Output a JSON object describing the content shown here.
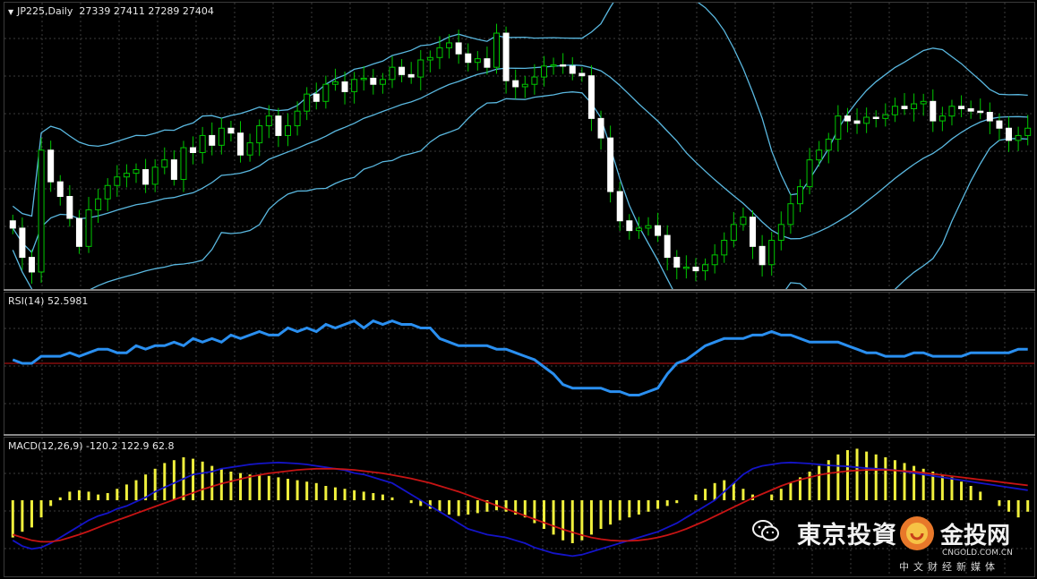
{
  "price_pane": {
    "symbol": "JP225,Daily",
    "ohlc": "27339 27411 27289 27404",
    "colors": {
      "bull": "#00c800",
      "bear": "#ffffff",
      "bands": "#5ab8e0",
      "grid": "#3c3c3c"
    },
    "chart_data": {
      "type": "candlestick",
      "bar_count": 108,
      "overlay": "Bollinger Bands",
      "closes": [
        26800,
        26560,
        26440,
        27440,
        27180,
        27060,
        26880,
        26650,
        26950,
        27040,
        27150,
        27220,
        27250,
        27280,
        27160,
        27300,
        27360,
        27200,
        27460,
        27420,
        27560,
        27480,
        27620,
        27580,
        27400,
        27500,
        27640,
        27720,
        27560,
        27640,
        27760,
        27900,
        27840,
        27980,
        28000,
        27920,
        28020,
        28030,
        27980,
        28020,
        28120,
        28060,
        28040,
        28180,
        28200,
        28280,
        28320,
        28230,
        28160,
        28190,
        28120,
        28400,
        28010,
        27960,
        27980,
        28040,
        28130,
        28140,
        28130,
        28070,
        28050,
        27700,
        27540,
        27100,
        26860,
        26780,
        26800,
        26820,
        26740,
        26560,
        26480,
        26480,
        26450,
        26500,
        26580,
        26700,
        26830,
        26890,
        26650,
        26500,
        26700,
        26830,
        27000,
        27140,
        27360,
        27440,
        27530,
        27720,
        27680,
        27660,
        27710,
        27700,
        27730,
        27800,
        27780,
        27820,
        27840,
        27680,
        27720,
        27800,
        27780,
        27760,
        27750,
        27680,
        27620,
        27520,
        27560,
        27620
      ]
    }
  },
  "rsi_pane": {
    "label": "RSI(14) 52.5981",
    "colors": {
      "line": "#2a8ff0",
      "level": "#c81414"
    },
    "chart_data": {
      "type": "line",
      "series": [
        {
          "name": "RSI(14)",
          "values": [
            51,
            50,
            50,
            52,
            52,
            52,
            53,
            52,
            53,
            54,
            54,
            53,
            53,
            55,
            54,
            55,
            55,
            56,
            55,
            57,
            56,
            57,
            56,
            58,
            57,
            58,
            59,
            58,
            58,
            60,
            59,
            60,
            59,
            61,
            60,
            61,
            62,
            60,
            62,
            61,
            62,
            61,
            61,
            60,
            60,
            57,
            56,
            55,
            55,
            55,
            55,
            54,
            54,
            53,
            52,
            51,
            49,
            47,
            44,
            43,
            43,
            43,
            43,
            42,
            42,
            41,
            41,
            42,
            43,
            47,
            50,
            51,
            53,
            55,
            56,
            57,
            57,
            57,
            58,
            58,
            59,
            58,
            58,
            57,
            56,
            56,
            56,
            56,
            55,
            54,
            53,
            53,
            52,
            52,
            52,
            53,
            53,
            52,
            52,
            52,
            52,
            53,
            53,
            53,
            53,
            53,
            54,
            54
          ]
        }
      ],
      "level": 50
    }
  },
  "macd_pane": {
    "label": "MACD(12,26,9) -120.2 122.9 62.8",
    "colors": {
      "histogram": "#f0f03c",
      "macd_line": "#1414c8",
      "signal_line": "#c81414"
    },
    "chart_data": {
      "type": "bar+line",
      "histogram": [
        -130,
        -110,
        -95,
        -60,
        -20,
        10,
        30,
        35,
        30,
        20,
        25,
        40,
        55,
        70,
        90,
        110,
        130,
        140,
        150,
        145,
        135,
        120,
        110,
        100,
        95,
        90,
        88,
        85,
        80,
        75,
        70,
        65,
        60,
        50,
        45,
        40,
        35,
        30,
        25,
        20,
        10,
        0,
        -10,
        -20,
        -30,
        -40,
        -50,
        -55,
        -50,
        -45,
        -40,
        -35,
        -40,
        -50,
        -60,
        -80,
        -100,
        -120,
        -140,
        -150,
        -140,
        -120,
        -100,
        -85,
        -70,
        -60,
        -50,
        -40,
        -30,
        -20,
        -10,
        0,
        20,
        40,
        60,
        70,
        60,
        40,
        20,
        0,
        20,
        40,
        60,
        80,
        100,
        120,
        140,
        160,
        175,
        180,
        170,
        160,
        150,
        140,
        130,
        120,
        110,
        100,
        90,
        80,
        65,
        50,
        30,
        0,
        -20,
        -40,
        -60,
        -40
      ],
      "series": [
        {
          "name": "MACD",
          "values": [
            -140,
            -160,
            -170,
            -165,
            -150,
            -130,
            -110,
            -90,
            -70,
            -55,
            -45,
            -30,
            -20,
            -5,
            10,
            30,
            45,
            60,
            75,
            90,
            95,
            100,
            110,
            115,
            120,
            125,
            128,
            130,
            132,
            130,
            128,
            125,
            120,
            115,
            110,
            105,
            95,
            90,
            80,
            70,
            60,
            40,
            20,
            0,
            -20,
            -40,
            -60,
            -80,
            -100,
            -110,
            -120,
            -125,
            -130,
            -140,
            -150,
            -165,
            -175,
            -185,
            -190,
            -195,
            -190,
            -180,
            -170,
            -160,
            -150,
            -140,
            -130,
            -120,
            -110,
            -95,
            -80,
            -60,
            -40,
            -20,
            0,
            30,
            60,
            90,
            110,
            120,
            125,
            130,
            132,
            130,
            128,
            125,
            122,
            120,
            118,
            115,
            112,
            110,
            108,
            105,
            100,
            95,
            90,
            85,
            80,
            75,
            70,
            65,
            60,
            55,
            50,
            45,
            40,
            35
          ]
        },
        {
          "name": "Signal",
          "values": [
            -120,
            -130,
            -140,
            -145,
            -145,
            -140,
            -130,
            -120,
            -108,
            -95,
            -82,
            -70,
            -58,
            -46,
            -34,
            -22,
            -10,
            2,
            14,
            26,
            38,
            48,
            58,
            66,
            74,
            82,
            88,
            94,
            98,
            102,
            106,
            108,
            110,
            110,
            110,
            108,
            106,
            102,
            98,
            94,
            88,
            82,
            76,
            68,
            60,
            50,
            40,
            30,
            18,
            6,
            -6,
            -18,
            -30,
            -42,
            -54,
            -66,
            -78,
            -90,
            -102,
            -112,
            -122,
            -130,
            -136,
            -140,
            -142,
            -142,
            -140,
            -136,
            -130,
            -122,
            -112,
            -100,
            -86,
            -72,
            -56,
            -40,
            -24,
            -8,
            8,
            22,
            36,
            50,
            62,
            72,
            80,
            88,
            94,
            98,
            102,
            104,
            106,
            106,
            106,
            104,
            102,
            100,
            96,
            92,
            88,
            84,
            80,
            76,
            72,
            68,
            64,
            60,
            56,
            52
          ]
        }
      ]
    }
  },
  "watermark": {
    "name": "東京投資",
    "site": "金投网",
    "domain": "CNGOLD.COM.CN",
    "tagline": "中文财经新媒体"
  }
}
